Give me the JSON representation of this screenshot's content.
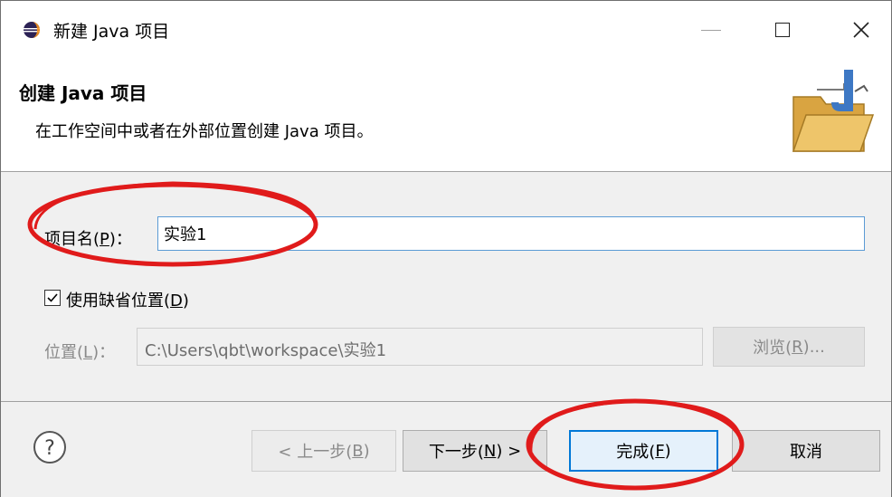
{
  "window": {
    "title": "新建 Java 项目"
  },
  "header": {
    "title": "创建 Java 项目",
    "description": "在工作空间中或者在外部位置创建 Java 项目。"
  },
  "form": {
    "project_name_label_prefix": "项目名(",
    "project_name_label_key": "P",
    "project_name_label_suffix": ")：",
    "project_name_value": "实验1",
    "use_default_label_prefix": "使用缺省位置(",
    "use_default_label_key": "D",
    "use_default_label_suffix": ")",
    "use_default_checked": true,
    "location_label_prefix": "位置(",
    "location_label_key": "L",
    "location_label_suffix": ")：",
    "location_value": "C:\\Users\\qbt\\workspace\\实验1",
    "browse_prefix": "浏览(",
    "browse_key": "R",
    "browse_suffix": ")..."
  },
  "footer": {
    "prev_prefix": "< 上一步(",
    "prev_key": "B",
    "prev_suffix": ")",
    "next_prefix": "下一步(",
    "next_key": "N",
    "next_suffix": ") >",
    "finish_prefix": "完成(",
    "finish_key": "F",
    "finish_suffix": ")",
    "cancel_label": "取消"
  },
  "colors": {
    "annotation": "#e01b1b",
    "focus_border": "#0078d7"
  },
  "icons": {
    "app": "eclipse-icon",
    "header": "java-project-folder-icon",
    "help": "help-icon"
  }
}
